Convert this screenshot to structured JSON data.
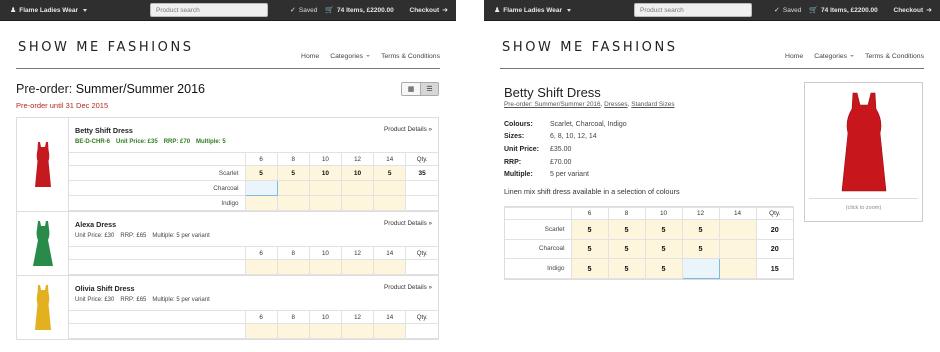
{
  "topbar": {
    "account": "Flame Ladies Wear",
    "search_placeholder": "Product search",
    "saved": "Saved",
    "cart": "74 Items, £2200.00",
    "checkout": "Checkout"
  },
  "brand": "SHOW ME FASHIONS",
  "nav": {
    "home": "Home",
    "categories": "Categories",
    "terms": "Terms & Conditions"
  },
  "preorder": {
    "prefix": "Pre-order:",
    "season": "Summer/Summer 2016",
    "until": "Pre-order until 31 Dec 2015"
  },
  "sizes": [
    "6",
    "8",
    "10",
    "12",
    "14"
  ],
  "qty_label": "Qty.",
  "products": [
    {
      "name": "Betty Shift Dress",
      "details_label": "Product Details »",
      "sku": "BE-D-CHR-6",
      "unit_price": "Unit Price: £35",
      "rrp": "RRP: £70",
      "multiple": "Multiple: 5",
      "image_color": "#c41a1f",
      "rows": [
        {
          "colour": "Scarlet",
          "values": [
            "5",
            "5",
            "10",
            "10",
            "5"
          ],
          "qty": "35"
        },
        {
          "colour": "Charcoal",
          "values": [
            "",
            "",
            "",
            "",
            ""
          ],
          "qty": ""
        },
        {
          "colour": "Indigo",
          "values": [
            "",
            "",
            "",
            "",
            ""
          ],
          "qty": ""
        }
      ]
    },
    {
      "name": "Alexa Dress",
      "details_label": "Product Details »",
      "unit_price": "Unit Price: £30",
      "rrp": "RRP: £65",
      "multiple": "Multiple: 5 per variant",
      "image_color": "#2a8a4a",
      "rows": [
        {
          "colour": "",
          "values": [
            "",
            "",
            "",
            "",
            ""
          ],
          "qty": ""
        }
      ]
    },
    {
      "name": "Olivia Shift Dress",
      "details_label": "Product Details »",
      "unit_price": "Unit Price: £30",
      "rrp": "RRP: £65",
      "multiple": "Multiple: 5 per variant",
      "image_color": "#e3b020",
      "rows": [
        {
          "colour": "",
          "values": [
            "",
            "",
            "",
            "",
            ""
          ],
          "qty": ""
        }
      ]
    }
  ],
  "detail": {
    "title": "Betty Shift Dress",
    "crumbs": [
      "Pre-order: Summer/Summer 2016",
      "Dresses",
      "Standard Sizes"
    ],
    "attrs": [
      {
        "k": "Colours:",
        "v": "Scarlet, Charcoal, Indigo"
      },
      {
        "k": "Sizes:",
        "v": "6, 8, 10, 12, 14"
      },
      {
        "k": "Unit Price:",
        "v": "£35.00"
      },
      {
        "k": "RRP:",
        "v": "£70.00"
      },
      {
        "k": "Multiple:",
        "v": "5 per variant"
      }
    ],
    "description": "Linen mix shift dress available in a selection of colours",
    "zoom_caption": "(click to zoom)",
    "rows": [
      {
        "colour": "Scarlet",
        "values": [
          "5",
          "5",
          "5",
          "5",
          ""
        ],
        "qty": "20"
      },
      {
        "colour": "Charcoal",
        "values": [
          "5",
          "5",
          "5",
          "5",
          ""
        ],
        "qty": "20"
      },
      {
        "colour": "Indigo",
        "values": [
          "5",
          "5",
          "5",
          "",
          ""
        ],
        "qty": "15"
      }
    ]
  }
}
